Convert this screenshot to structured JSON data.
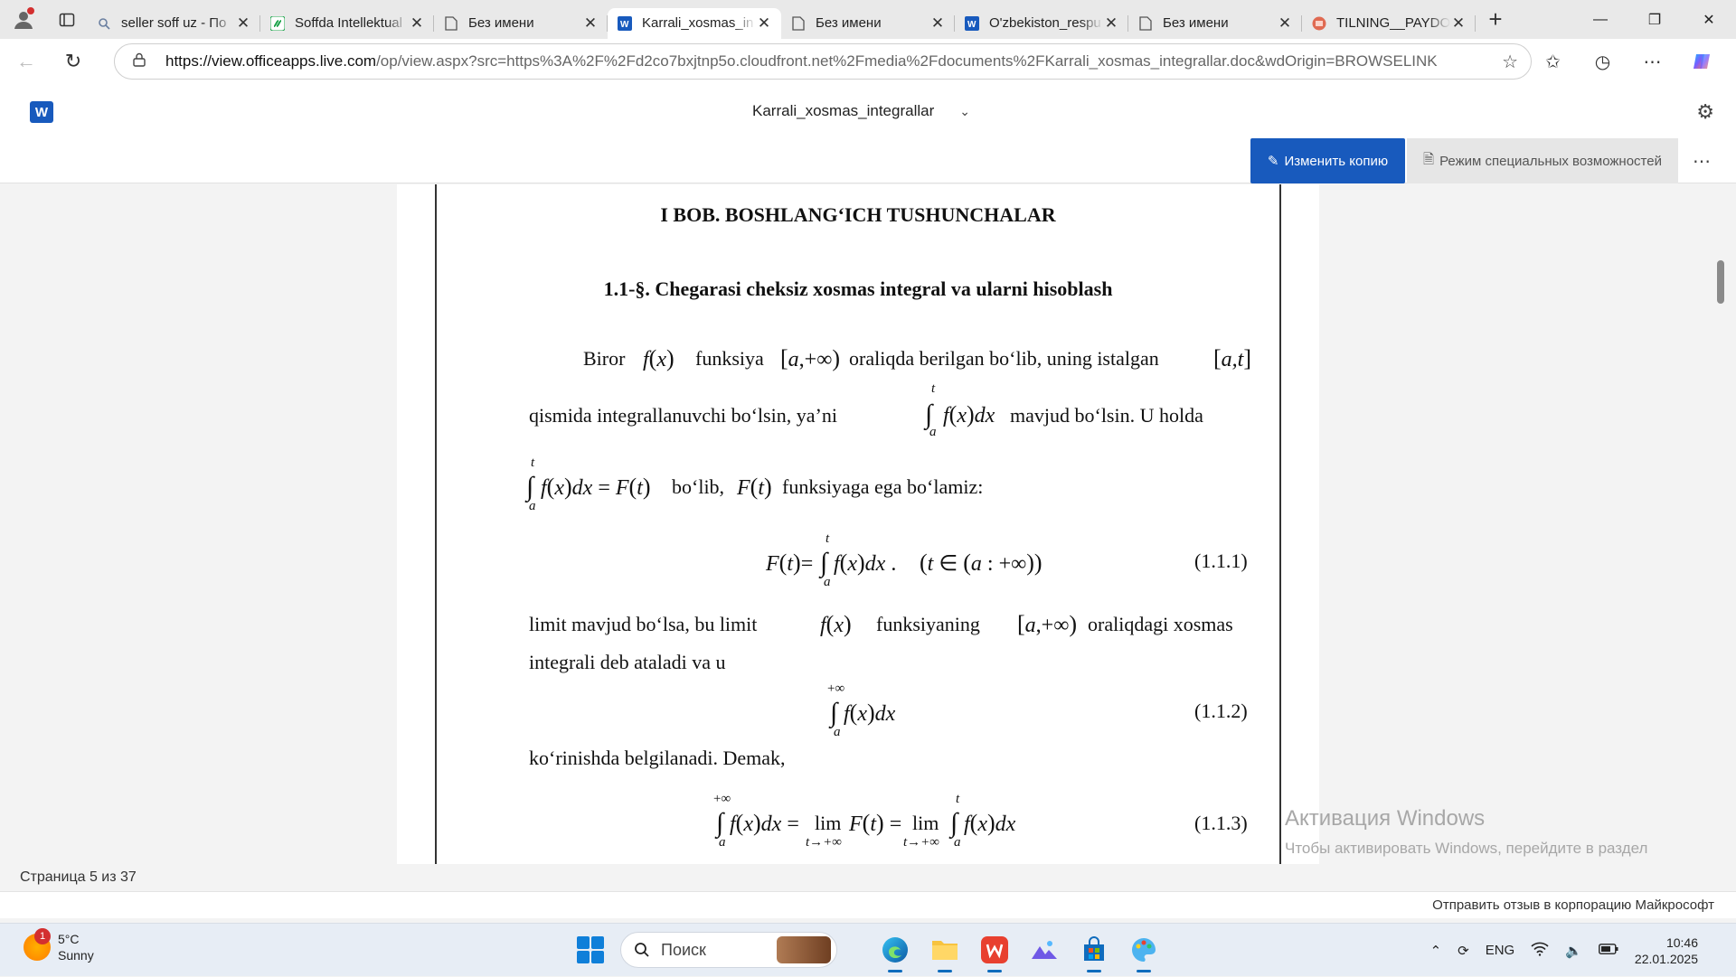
{
  "browser": {
    "tabs": [
      {
        "label": "seller soff uz - По",
        "icon": "search-icon",
        "active": false
      },
      {
        "label": "Soffda Intellektual",
        "icon": "soff-icon",
        "active": false
      },
      {
        "label": "Без имени",
        "icon": "page-icon",
        "active": false
      },
      {
        "label": "Karrali_xosmas_in",
        "icon": "word-icon",
        "active": true
      },
      {
        "label": "Без имени",
        "icon": "page-icon",
        "active": false
      },
      {
        "label": "O'zbekiston_respu",
        "icon": "word-icon",
        "active": false
      },
      {
        "label": "Без имени",
        "icon": "page-icon",
        "active": false
      },
      {
        "label": "TILNING__PAYDO",
        "icon": "powerpoint-icon",
        "active": false
      }
    ],
    "url_host": "https://view.officeapps.live.com",
    "url_path": "/op/view.aspx?src=https%3A%2F%2Fd2co7bxjtnp5o.cloudfront.net%2Fmedia%2Fdocuments%2FKarrali_xosmas_integrallar.doc&wdOrigin=BROWSELINK"
  },
  "word": {
    "doc_title": "Karrali_xosmas_integrallar",
    "edit_copy_label": "Изменить копию",
    "accessibility_label": "Режим специальных возможностей"
  },
  "document": {
    "chapter_title": "I BOB. BOSHLANG‘ICH TUSHUNCHALAR",
    "section_title": "1.1-§.  Chegarasi cheksiz xosmas integral va ularni hisoblash",
    "p1_w1": "Biror",
    "p1_w2": "funksiya",
    "p1_w3": "oraliqda  berilgan  bo‘lib,  uning  istalgan",
    "p2_w1": "qismida  integrallanuvchi  bo‘lsin,  ya’ni",
    "p2_w2": "mavjud  bo‘lsin.  U  holda",
    "p3_w1": "bo‘lib,",
    "p3_w2": "funksiyaga ega bo‘lamiz:",
    "eq1_num": "(1.1.1)",
    "p4_w1": "limit  mavjud  bo‘lsa,  bu  limit",
    "p4_w2": "funksiyaning",
    "p4_w3": "oraliqdagi  xosmas",
    "p5": "integrali deb ataladi  va u",
    "eq2_num": "(1.1.2)",
    "p6": "ko‘rinishda belgilanadi.  Demak,",
    "eq3_num": "(1.1.3)"
  },
  "status": {
    "page_info": "Страница 5 из 37",
    "feedback": "Отправить отзыв в корпорацию Майкрософт"
  },
  "watermark": {
    "title": "Активация Windows",
    "text": "Чтобы активировать Windows, перейдите в раздел \"Параметры\"."
  },
  "taskbar": {
    "weather_temp": "5°C",
    "weather_desc": "Sunny",
    "weather_badge": "1",
    "search_placeholder": "Поиск",
    "language": "ENG",
    "time": "10:46",
    "date": "22.01.2025"
  }
}
